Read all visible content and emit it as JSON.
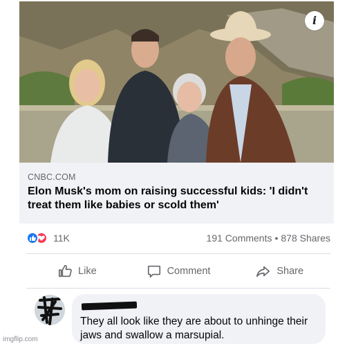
{
  "post": {
    "image_info_label": "i",
    "link": {
      "domain": "CNBC.COM",
      "headline": "Elon Musk's mom on raising successful kids: 'I didn't treat them like babies or scold them'"
    },
    "reactions": {
      "count": "11K",
      "comments": "191 Comments",
      "separator": "•",
      "shares": "878 Shares"
    },
    "actions": {
      "like": "Like",
      "comment": "Comment",
      "share": "Share"
    },
    "comment": {
      "text": "They all look like they are about to unhinge their jaws and swallow a marsupial."
    }
  },
  "watermark": "imgflip.com",
  "colors": {
    "like_blue": "#1877f2",
    "love_red": "#f33e58",
    "bubble_gray": "#f0f2f5",
    "muted_text": "#65676b"
  }
}
